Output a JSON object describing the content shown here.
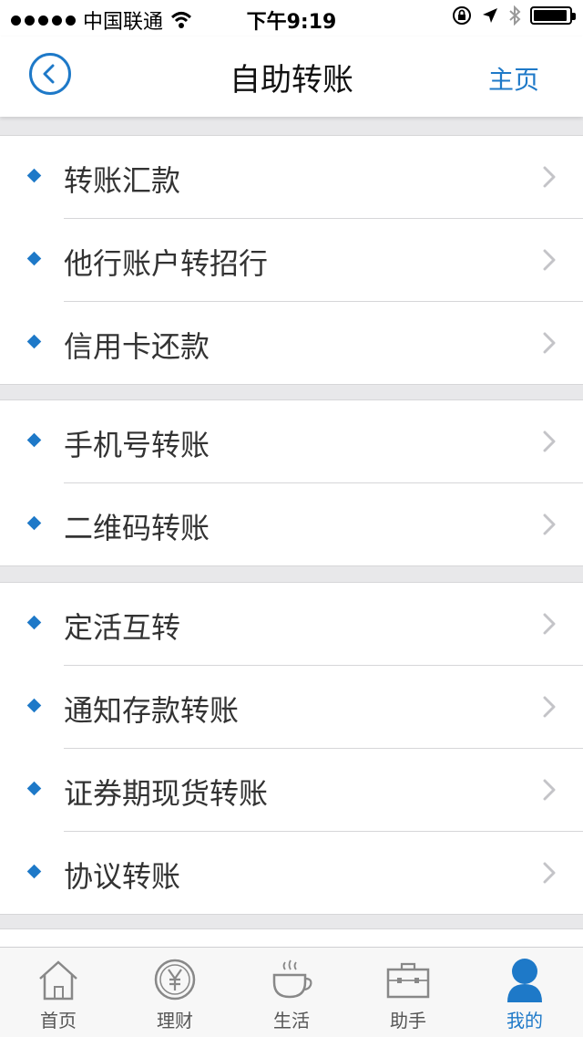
{
  "status": {
    "carrier": "中国联通",
    "time": "下午9:19"
  },
  "nav": {
    "title": "自助转账",
    "home": "主页"
  },
  "groups": [
    {
      "items": [
        {
          "label": "转账汇款"
        },
        {
          "label": "他行账户转招行"
        },
        {
          "label": "信用卡还款"
        }
      ]
    },
    {
      "items": [
        {
          "label": "手机号转账"
        },
        {
          "label": "二维码转账"
        }
      ]
    },
    {
      "items": [
        {
          "label": "定活互转"
        },
        {
          "label": "通知存款转账"
        },
        {
          "label": "证券期现货转账"
        },
        {
          "label": "协议转账"
        }
      ]
    }
  ],
  "tabs": [
    {
      "label": "首页",
      "icon": "home-icon"
    },
    {
      "label": "理财",
      "icon": "yuan-icon"
    },
    {
      "label": "生活",
      "icon": "coffee-cup-icon"
    },
    {
      "label": "助手",
      "icon": "briefcase-icon"
    },
    {
      "label": "我的",
      "icon": "user-icon",
      "active": true
    }
  ],
  "colors": {
    "accent": "#1e79c8"
  }
}
